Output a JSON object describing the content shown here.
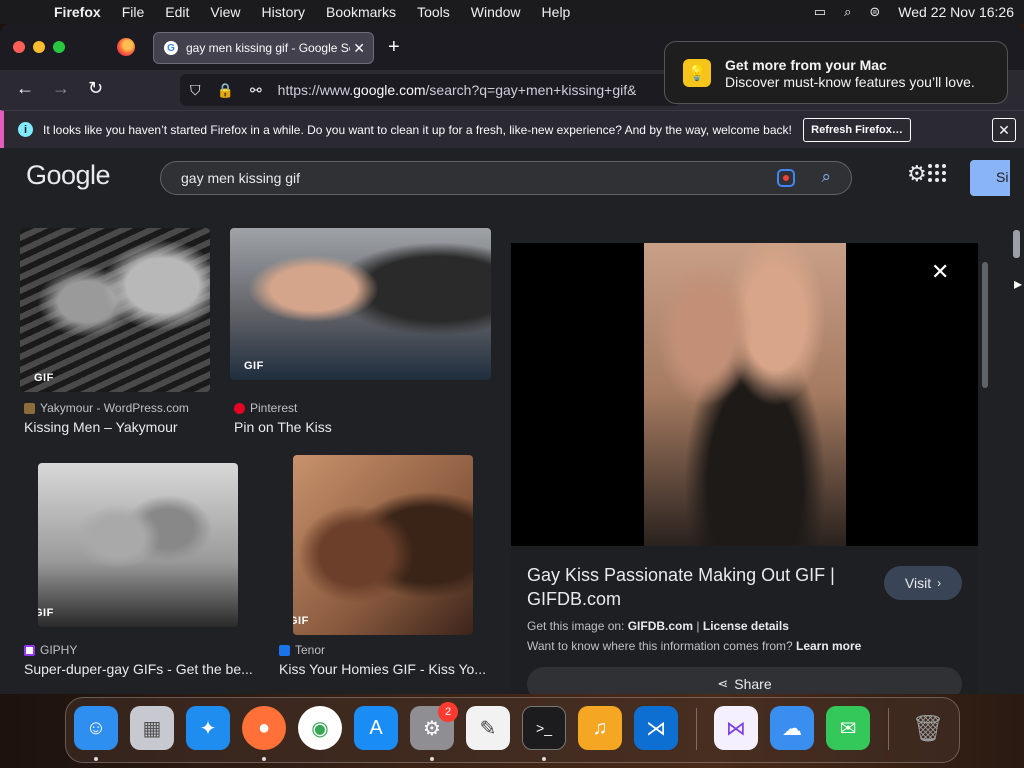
{
  "menubar": {
    "apple": "",
    "items": [
      "Firefox",
      "File",
      "Edit",
      "View",
      "History",
      "Bookmarks",
      "Tools",
      "Window",
      "Help"
    ],
    "datetime": "Wed 22 Nov  16:26"
  },
  "browser": {
    "tab_title": "gay men kissing gif - Google Se",
    "tab_close": "✕",
    "new_tab": "+",
    "url_prefix": "https://www.",
    "url_domain": "google.com",
    "url_suffix": "/search?q=gay+men+kissing+gif&",
    "infobar_message": "It looks like you haven’t started Firefox in a while. Do you want to clean it up for a fresh, like-new experience? And by the way, welcome back!",
    "refresh_label": "Refresh Firefox…",
    "infobar_close": "✕"
  },
  "google": {
    "logo": "Google",
    "query": "gay men kissing gif",
    "signin_label": "Si"
  },
  "results": [
    {
      "source": "Yakymour - WordPress.com",
      "title": "Kissing Men – Yakymour",
      "badge": "GIF",
      "fav_color": "#8a6d3b"
    },
    {
      "source": "Pinterest",
      "title": "Pin on The Kiss",
      "badge": "GIF",
      "fav_color": "#e60023"
    },
    {
      "source": "GIPHY",
      "title": "Super-duper-gay GIFs - Get the be...",
      "badge": "GIF",
      "fav_color": "#ffffff"
    },
    {
      "source": "Tenor",
      "title": "Kiss Your Homies GIF - Kiss Yo...",
      "badge": "GIF",
      "fav_color": "#1a73e8"
    }
  ],
  "preview": {
    "title": "Gay Kiss Passionate Making Out GIF | GIFDB.com",
    "visit_label": "Visit",
    "src_prefix": "Get this image on: ",
    "src_site": "GIFDB.com",
    "src_sep": " | ",
    "license": "License details",
    "info_q": "Want to know where this information comes from? ",
    "learn_more": "Learn more",
    "share_label": "Share",
    "close": "✕"
  },
  "notification": {
    "title": "Get more from your Mac",
    "body": "Discover must-know features you’ll love."
  },
  "dock": {
    "badge_count": "2",
    "apps": [
      {
        "name": "finder",
        "glyph": "☺",
        "color": "#2f8ff0"
      },
      {
        "name": "launchpad",
        "glyph": "▦",
        "color": "#c8c8d0"
      },
      {
        "name": "safari",
        "glyph": "✦",
        "color": "#1f8cf0"
      },
      {
        "name": "firefox",
        "glyph": "●",
        "color": "#ff7139"
      },
      {
        "name": "chrome",
        "glyph": "◉",
        "color": "#34a853"
      },
      {
        "name": "app-store",
        "glyph": "A",
        "color": "#1a8cf5"
      },
      {
        "name": "system-settings",
        "glyph": "⚙",
        "color": "#8e8e93"
      },
      {
        "name": "textedit",
        "glyph": "✎",
        "color": "#f2f2f2"
      },
      {
        "name": "terminal",
        "glyph": ">_",
        "color": "#1c1c1e"
      },
      {
        "name": "garageband",
        "glyph": "♫",
        "color": "#f5a623"
      },
      {
        "name": "vscode",
        "glyph": "⋊",
        "color": "#0d6fd1"
      },
      {
        "name": "visual-studio",
        "glyph": "⋈",
        "color": "#f5f0ff"
      },
      {
        "name": "weather",
        "glyph": "☁",
        "color": "#3a8ef0"
      },
      {
        "name": "messages",
        "glyph": "✉",
        "color": "#34c759"
      },
      {
        "name": "trash",
        "glyph": "🗑",
        "color": "#9a9a9a"
      }
    ]
  }
}
